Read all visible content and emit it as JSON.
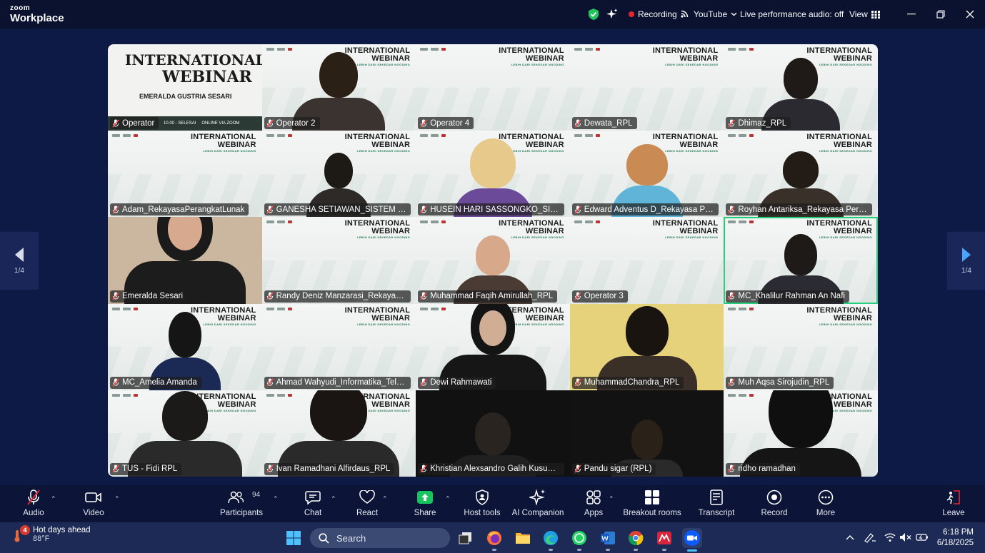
{
  "app": {
    "brand_top": "zoom",
    "brand_bottom": "Workplace"
  },
  "topbar": {
    "recording_label": "Recording",
    "stream_label": "YouTube",
    "audio_status": "Live performance audio: off",
    "view_label": "View"
  },
  "pager": {
    "left": "1/4",
    "right": "1/4"
  },
  "slide": {
    "headline_1": "INTERNATIONAL",
    "headline_2": "WEBINAR",
    "tagline": "LEBIH DARI SEKEDAR NGODING"
  },
  "first_slide": {
    "title_1": "INTERNATIONAL",
    "title_2": "WEBINAR",
    "speaker": "EMERALDA GUSTRIA SESARI",
    "time": "10.00 - SELESAI",
    "place": "ONLINE VIA ZOOM"
  },
  "participants": [
    "Operator",
    "Operator 2",
    "Operator 4",
    "Dewata_RPL",
    "Dhimaz_RPL",
    "Adam_RekayasaPerangkatLunak",
    "GANESHA SETIAWAN_SISTEM INFOR...",
    "HUSEIN HARI SASSONGKO_SISTEM I...",
    "Edward Adventus D_Rekayasa Peran...",
    "Royhan Antariksa_Rekayasa Perangk...",
    "Emeralda Sesari",
    "Randy Deniz Manzarasi_Rekayasa Pe...",
    "Muhammad Faqih Amirullah_RPL",
    "Operator 3",
    "MC_Khalilur Rahman An Nafi",
    "MC_Amelia Amanda",
    "Ahmad Wahyudi_Informatika_Telkom...",
    "Dewi Rahmawati",
    "MuhammadChandra_RPL",
    "Muh Aqsa Sirojudin_RPL",
    "TUS - Fidi RPL",
    "Ivan Ramadhani Alfirdaus_RPL",
    "Khristian Alexsandro Galih Kusuma 1...",
    "Pandu sigar (RPL)",
    "ridho ramadhan"
  ],
  "toolbar": {
    "audio": "Audio",
    "video": "Video",
    "participants": "Participants",
    "participants_count": "94",
    "chat": "Chat",
    "react": "React",
    "share": "Share",
    "host_tools": "Host tools",
    "ai_companion": "AI Companion",
    "apps": "Apps",
    "breakout_rooms": "Breakout rooms",
    "transcript": "Transcript",
    "record": "Record",
    "more": "More",
    "leave": "Leave"
  },
  "taskbar": {
    "weather_title": "Hot days ahead",
    "weather_temp": "88°F",
    "weather_badge": "4",
    "search_placeholder": "Search",
    "time": "6:18 PM",
    "date": "6/18/2025"
  },
  "colors": {
    "recording": "#e8262f",
    "active_speaker": "#1fd27a",
    "share": "#17c45e",
    "shield": "#22c55e"
  }
}
